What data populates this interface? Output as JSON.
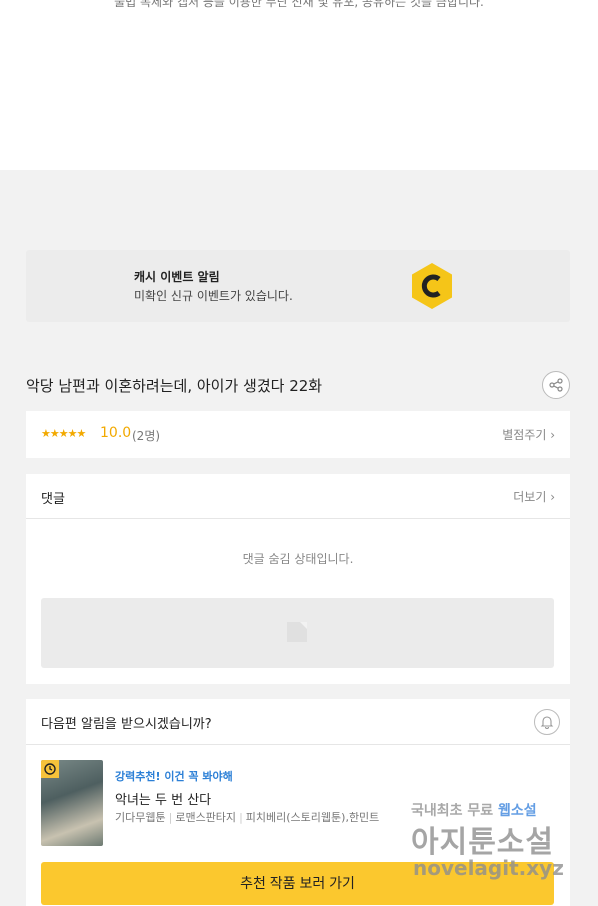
{
  "top": {
    "notice": "불법 복제와 캡처 등을 이용한 무단 전재 및 유포, 공유하는 것을 금합니다."
  },
  "banner": {
    "title": "캐시 이벤트 알림",
    "subtitle": "미확인 신규 이벤트가 있습니다.",
    "icon": "cash-c-icon",
    "icon_color": "#f5c518"
  },
  "episode": {
    "title": "악당 남편과 이혼하려는데, 아이가 생겼다 22화"
  },
  "rating": {
    "stars": "★★★★★",
    "score": "10.0",
    "count": "(2명)",
    "rate_link": "별점주기 ›"
  },
  "comments": {
    "title": "댓글",
    "more": "더보기 ›",
    "hidden_message": "댓글 숨김 상태입니다."
  },
  "next": {
    "question": "다음편 알림을 받으시겠습니까?",
    "rec_label": "강력추천! 이건 꼭 봐야해",
    "rec_title": "악녀는 두 번 산다",
    "rec_meta": [
      "기다무웹툰",
      "로맨스판타지",
      "피치베리(스토리웹툰),한민트"
    ],
    "button": "추천 작품 보러 가기"
  },
  "watermark": {
    "line1_a": "국내최초 무료",
    "line1_b": "웹소설",
    "line2": "아지툰소설",
    "line3": "novelagit.xyz"
  },
  "colors": {
    "accent": "#fbc82e",
    "star": "#f2a900",
    "link_blue": "#2b7fd6"
  }
}
